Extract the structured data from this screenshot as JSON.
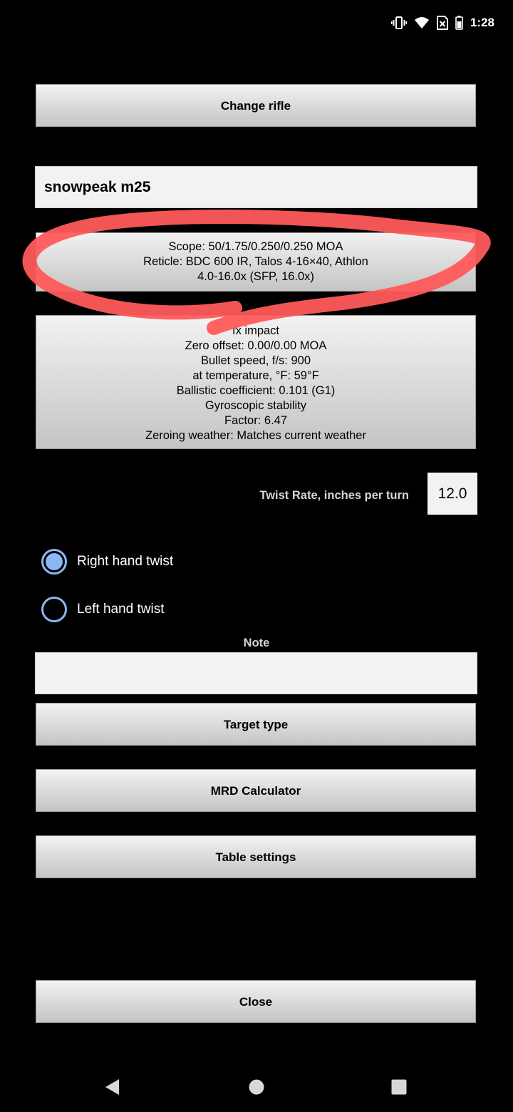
{
  "status_bar": {
    "time": "1:28",
    "icons": [
      "vibrate-icon",
      "wifi-icon",
      "no-sim-icon",
      "battery-icon"
    ]
  },
  "buttons": {
    "change_rifle": "Change rifle",
    "target_type": "Target type",
    "mrd_calculator": "MRD Calculator",
    "table_settings": "Table settings",
    "close": "Close"
  },
  "rifle_name": {
    "value": "snowpeak m25"
  },
  "scope": {
    "lines": [
      "Scope: 50/1.75/0.250/0.250 MOA",
      "Reticle: BDC 600 IR, Talos 4-16×40, Athlon",
      "4.0-16.0x (SFP, 16.0x)"
    ]
  },
  "zero_info": {
    "lines": [
      "fx impact",
      "Zero offset: 0.00/0.00 MOA",
      "Bullet speed, f/s: 900",
      "at temperature, °F: 59°F",
      "Ballistic coefficient: 0.101 (G1)",
      "Gyroscopic stability",
      "Factor: 6.47",
      "Zeroing weather: Matches current weather"
    ]
  },
  "twist": {
    "label": "Twist Rate, inches per turn",
    "value": "12.0",
    "options": [
      {
        "label": "Right hand twist",
        "selected": true
      },
      {
        "label": "Left hand twist",
        "selected": false
      }
    ]
  },
  "note": {
    "label": "Note",
    "value": ""
  },
  "colors": {
    "background": "#000000",
    "button_top": "#f2f2f2",
    "button_bottom": "#c4c4c4",
    "radio_accent": "#8db7f2",
    "annotation_red": "#ff5a5a"
  }
}
